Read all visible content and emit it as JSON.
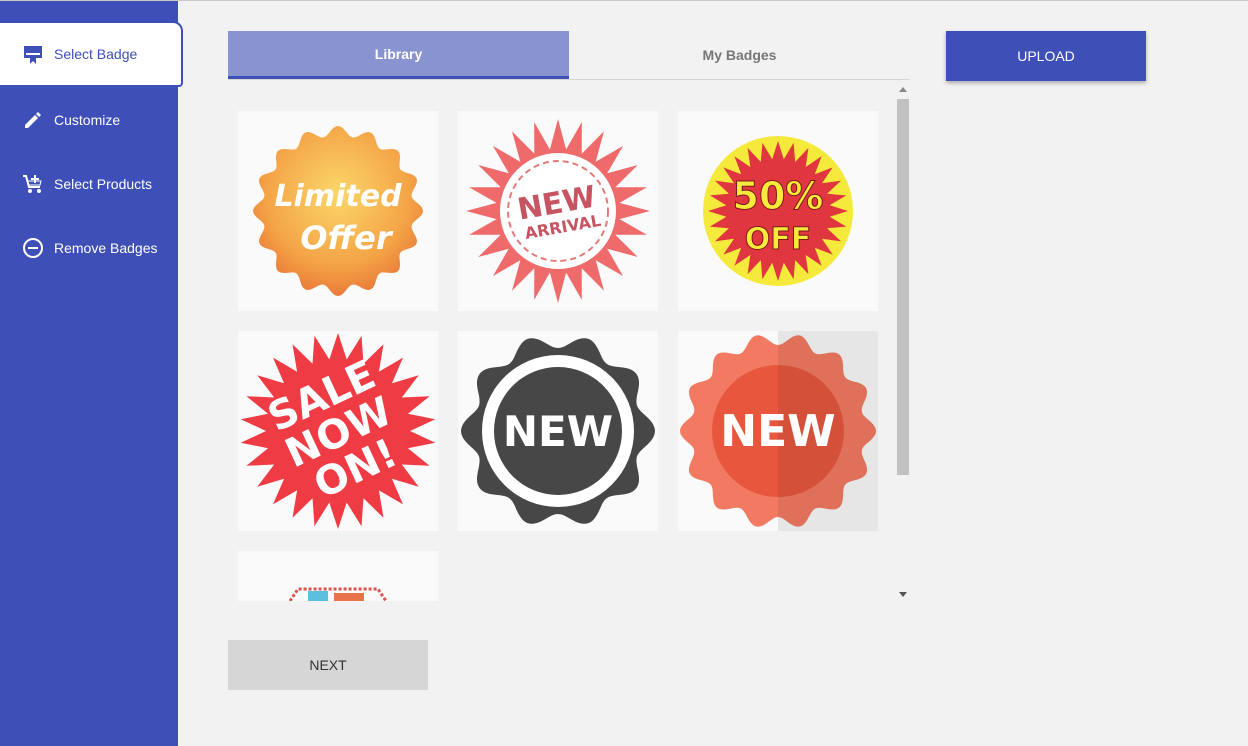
{
  "sidebar": {
    "items": [
      {
        "label": "Select Badge",
        "icon": "badge-icon"
      },
      {
        "label": "Customize",
        "icon": "pencil-icon"
      },
      {
        "label": "Select Products",
        "icon": "add-cart-icon"
      },
      {
        "label": "Remove Badges",
        "icon": "minus-circle-icon"
      }
    ]
  },
  "tabs": [
    {
      "label": "Library"
    },
    {
      "label": "My Badges"
    }
  ],
  "upload_label": "UPLOAD",
  "next_label": "NEXT",
  "badges": [
    {
      "line1": "Limited",
      "line2": "Offer"
    },
    {
      "line1": "NEW",
      "line2": "ARRIVAL"
    },
    {
      "line1": "50%",
      "line2": "OFF"
    },
    {
      "line1": "SALE",
      "line2": "NOW",
      "line3": "ON!"
    },
    {
      "line1": "NEW"
    },
    {
      "line1": "NEW"
    }
  ],
  "colors": {
    "primary": "#3e4fb8",
    "tab_active": "#8893cf"
  }
}
